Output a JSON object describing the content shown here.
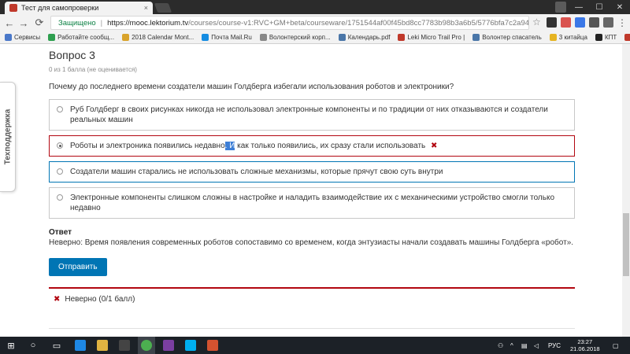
{
  "browser": {
    "tab_title": "Тест для самопроверки",
    "tab_close": "×",
    "secure_label": "Защищено",
    "separator": "|",
    "url_host": "https://mooc.lektorium.tv",
    "url_path": "/courses/course-v1:RVC+GM+beta/courseware/1751544af00f45bd8cc7783b98b3a6b5/5776bfa7c2a94d40b6f01b23955...",
    "window_controls": {
      "minimize": "—",
      "maximize": "☐",
      "close": "✕"
    }
  },
  "bookmarks": [
    {
      "label": "Сервисы",
      "color": "#4a78c9"
    },
    {
      "label": "Работайте сообщ...",
      "color": "#2e9f4f"
    },
    {
      "label": "2018 Calendar Mont...",
      "color": "#d9a32b"
    },
    {
      "label": "Почта Mail.Ru",
      "color": "#168de2"
    },
    {
      "label": "Волонтерский корп...",
      "color": "#888888"
    },
    {
      "label": "Календарь.pdf",
      "color": "#4a76a8"
    },
    {
      "label": "Leki Micro Trail Pro |",
      "color": "#c0392b"
    },
    {
      "label": "Волонтер спасатель",
      "color": "#4a76a8"
    },
    {
      "label": "3 китайца",
      "color": "#e6b422"
    },
    {
      "label": "КПТ",
      "color": "#222222"
    },
    {
      "label": "Лигурия",
      "color": "#c0392b"
    }
  ],
  "support_tab": "Техподдержка",
  "problem": {
    "title": "Вопрос 3",
    "score": "0 из 1 балла (не оценивается)",
    "question": "Почему до последнего времени создатели машин Голдберга избегали использования роботов и электроники?",
    "options": [
      {
        "text": "Руб Голдберг в своих рисунках никогда не использовал электронные компоненты и по традиции от них отказываются и создатели реальных машин",
        "state": "default"
      },
      {
        "text_before": "Роботы и электроника появились недавно",
        "text_selected": ". И",
        "text_after": " как только появились, их сразу стали использовать",
        "mark": "✖",
        "state": "selected-wrong"
      },
      {
        "text": "Создатели машин старались не использовать сложные механизмы, которые прячут свою суть внутри",
        "state": "focused"
      },
      {
        "text": "Электронные компоненты слишком сложны в настройке и наладить взаимодействие их с механическими устройство смогли только недавно",
        "state": "default"
      }
    ],
    "answer_label": "Ответ",
    "answer_text": "Неверно:  Время появления современных роботов сопоставимо со временем, когда энтузиасты начали создавать машины Голдберга «робот».",
    "submit_label": "Отправить",
    "status_mark": "✖",
    "status_text": "Неверно (0/1 балл)"
  },
  "taskbar": {
    "language": "РУС",
    "time": "23:27",
    "date": "21.06.2018"
  },
  "colors": {
    "accent": "#0075b4",
    "error": "#b20610",
    "secure": "#0b8043"
  }
}
